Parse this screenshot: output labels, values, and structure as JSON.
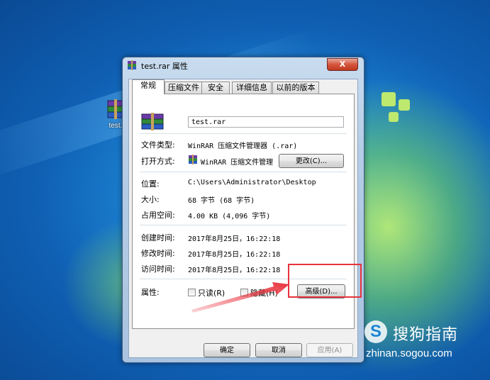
{
  "desktop": {
    "icon_label": "test."
  },
  "dialog": {
    "title": "test.rar 属性",
    "close_glyph": "X",
    "tabs": [
      "常规",
      "压缩文件",
      "安全",
      "详细信息",
      "以前的版本"
    ],
    "file_name": "test.rar",
    "rows": {
      "type_label": "文件类型:",
      "type_value": "WinRAR 压缩文件管理器 (.rar)",
      "open_label": "打开方式:",
      "open_value": "WinRAR 压缩文件管理",
      "change_button": "更改(C)...",
      "location_label": "位置:",
      "location_value": "C:\\Users\\Administrator\\Desktop",
      "size_label": "大小:",
      "size_value": "68 字节 (68 字节)",
      "disk_label": "占用空间:",
      "disk_value": "4.00 KB (4,096 字节)",
      "created_label": "创建时间:",
      "created_value": "2017年8月25日，16:22:18",
      "modified_label": "修改时间:",
      "modified_value": "2017年8月25日，16:22:18",
      "accessed_label": "访问时间:",
      "accessed_value": "2017年8月25日，16:22:18",
      "attr_label": "属性:",
      "readonly_label": "只读(R)",
      "hidden_label": "隐藏(H)",
      "advanced_button": "高级(D)..."
    },
    "footer": {
      "ok": "确定",
      "cancel": "取消",
      "apply": "应用(A)"
    }
  },
  "watermark": {
    "logo_letter": "S",
    "brand": "搜狗指南",
    "url": "zhinan.sogou.com"
  },
  "colors": {
    "annotation": "#e8323c",
    "desktop_blue": "#1d85d4"
  }
}
